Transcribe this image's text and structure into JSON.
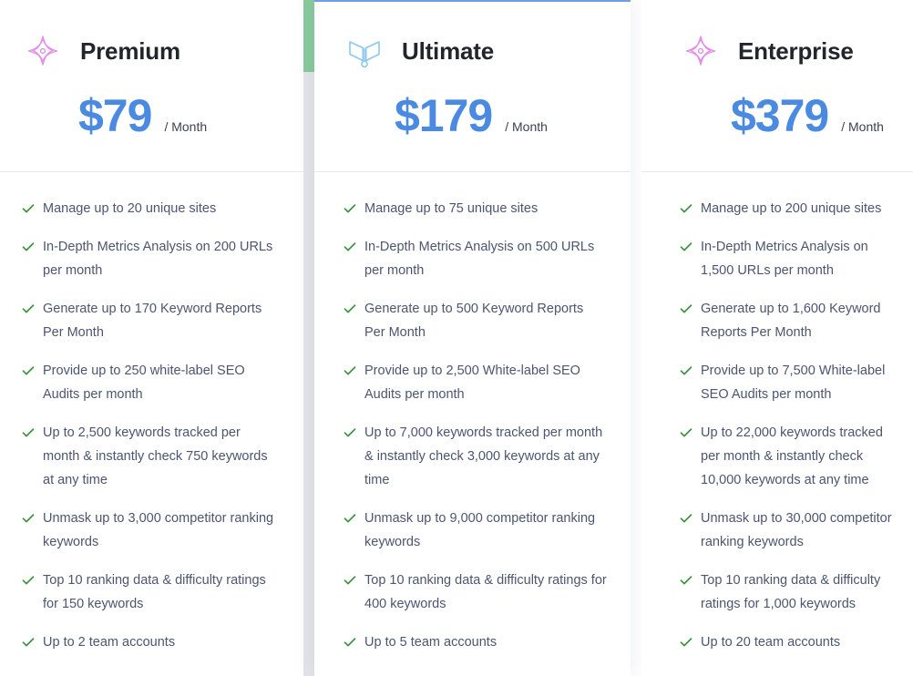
{
  "theme": {
    "price_color": "#4a8ae0",
    "accent_green": "#88cb9c",
    "check_green": "#3f9142",
    "separator_gray": "#e4e5ea",
    "text_color": "#4c5571",
    "title_color": "#22252b",
    "premium_icon_color": "#e48fe8",
    "ultimate_icon_color": "#8ec7ee",
    "featured_rule_color": "#6e9ee8"
  },
  "plans": [
    {
      "id": "premium",
      "name": "Premium",
      "icon": "four-point-star-icon",
      "price": "$79",
      "period": "/ Month",
      "featured": false,
      "features": [
        "Manage up to 20 unique sites",
        "In-Depth Metrics Analysis on 200 URLs per month",
        "Generate up to 170 Keyword Reports Per Month",
        "Provide up to 250 white-label SEO Audits per month",
        "Up to 2,500 keywords tracked per month & instantly check 750 keywords at any time",
        "Unmask up to 3,000 competitor ranking keywords",
        "Top 10 ranking data & difficulty ratings for 150 keywords",
        "Up to 2 team accounts"
      ]
    },
    {
      "id": "ultimate",
      "name": "Ultimate",
      "icon": "wings-icon",
      "price": "$179",
      "period": "/ Month",
      "featured": true,
      "features": [
        "Manage up to 75 unique sites",
        "In-Depth Metrics Analysis on 500 URLs per month",
        "Generate up to 500 Keyword Reports Per Month",
        "Provide up to 2,500 White-label SEO Audits per month",
        "Up to 7,000 keywords tracked per month & instantly check 3,000 keywords at any time",
        "Unmask up to 9,000 competitor ranking keywords",
        "Top 10 ranking data & difficulty ratings for 400 keywords",
        "Up to 5 team accounts"
      ]
    },
    {
      "id": "enterprise",
      "name": "Enterprise",
      "icon": "four-point-star-icon",
      "price": "$379",
      "period": "/ Month",
      "featured": false,
      "features": [
        "Manage up to 200 unique sites",
        "In-Depth Metrics Analysis on 1,500 URLs per month",
        "Generate up to 1,600 Keyword Reports Per Month",
        "Provide up to 7,500 White-label SEO Audits per month",
        "Up to 22,000 keywords tracked per month & instantly check 10,000 keywords at any time",
        "Unmask up to 30,000 competitor ranking keywords",
        "Top 10 ranking data & difficulty ratings for 1,000 keywords",
        "Up to 20 team accounts"
      ]
    }
  ]
}
